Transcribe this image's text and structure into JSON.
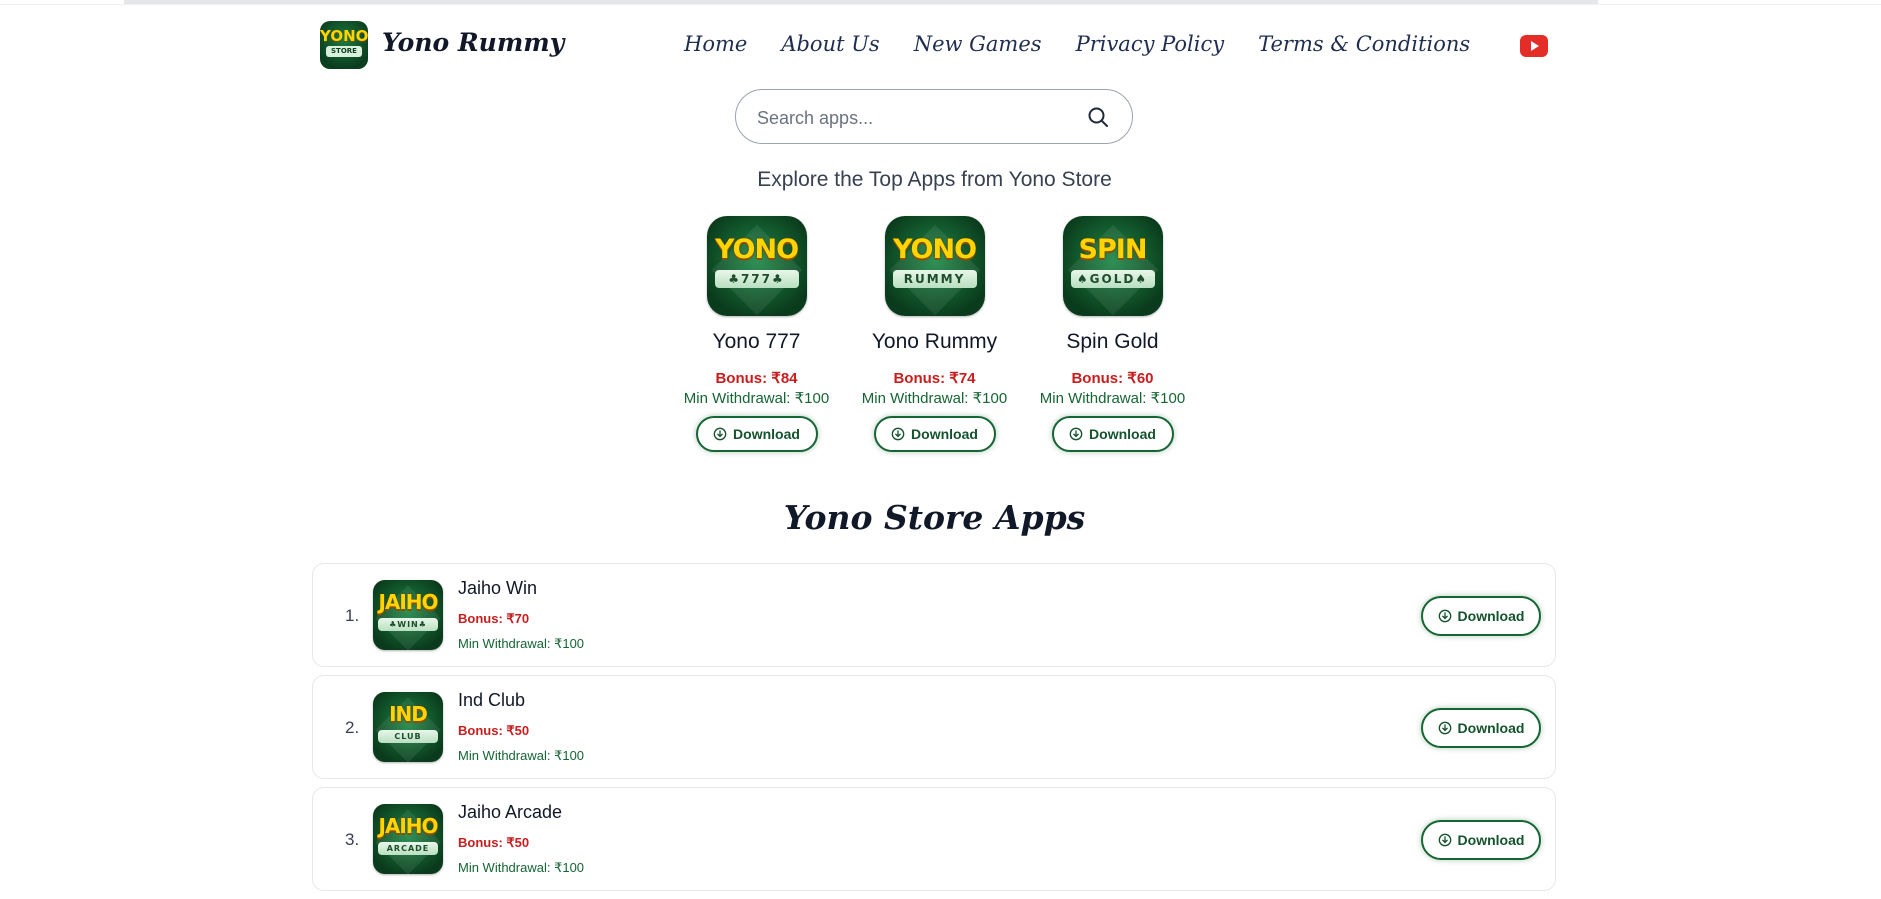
{
  "header": {
    "logo_line1": "YONO",
    "logo_line2": "STORE",
    "brand": "Yono Rummy",
    "nav": [
      "Home",
      "About Us",
      "New Games",
      "Privacy Policy",
      "Terms & Conditions"
    ],
    "youtube_icon": "youtube-icon"
  },
  "search": {
    "placeholder": "Search apps..."
  },
  "explore_heading": "Explore the Top Apps from Yono Store",
  "top_apps": [
    {
      "icon_top": "YONO",
      "icon_bottom": "♣777♣",
      "name": "Yono 777",
      "bonus": "Bonus: ₹84",
      "min_withdrawal": "Min Withdrawal: ₹100",
      "button": "Download"
    },
    {
      "icon_top": "YONO",
      "icon_bottom": "RUMMY",
      "name": "Yono Rummy",
      "bonus": "Bonus: ₹74",
      "min_withdrawal": "Min Withdrawal: ₹100",
      "button": "Download"
    },
    {
      "icon_top": "SPIN",
      "icon_bottom": "♠GOLD♠",
      "name": "Spin Gold",
      "bonus": "Bonus: ₹60",
      "min_withdrawal": "Min Withdrawal: ₹100",
      "button": "Download"
    }
  ],
  "section_title": "Yono Store Apps",
  "store_apps": [
    {
      "num": "1.",
      "icon_top": "JAIHO",
      "icon_bottom": "♣WIN♣",
      "name": "Jaiho Win",
      "bonus": "Bonus: ₹70",
      "min_withdrawal": "Min Withdrawal: ₹100",
      "button": "Download"
    },
    {
      "num": "2.",
      "icon_top": "IND",
      "icon_bottom": "CLUB",
      "name": "Ind Club",
      "bonus": "Bonus: ₹50",
      "min_withdrawal": "Min Withdrawal: ₹100",
      "button": "Download"
    },
    {
      "num": "3.",
      "icon_top": "JAIHO",
      "icon_bottom": "ARCADE",
      "name": "Jaiho Arcade",
      "bonus": "Bonus: ₹50",
      "min_withdrawal": "Min Withdrawal: ₹100",
      "button": "Download"
    }
  ],
  "colors": {
    "accent_green": "#166534",
    "bonus_red": "#c81e1e",
    "youtube_red": "#e52d27"
  }
}
